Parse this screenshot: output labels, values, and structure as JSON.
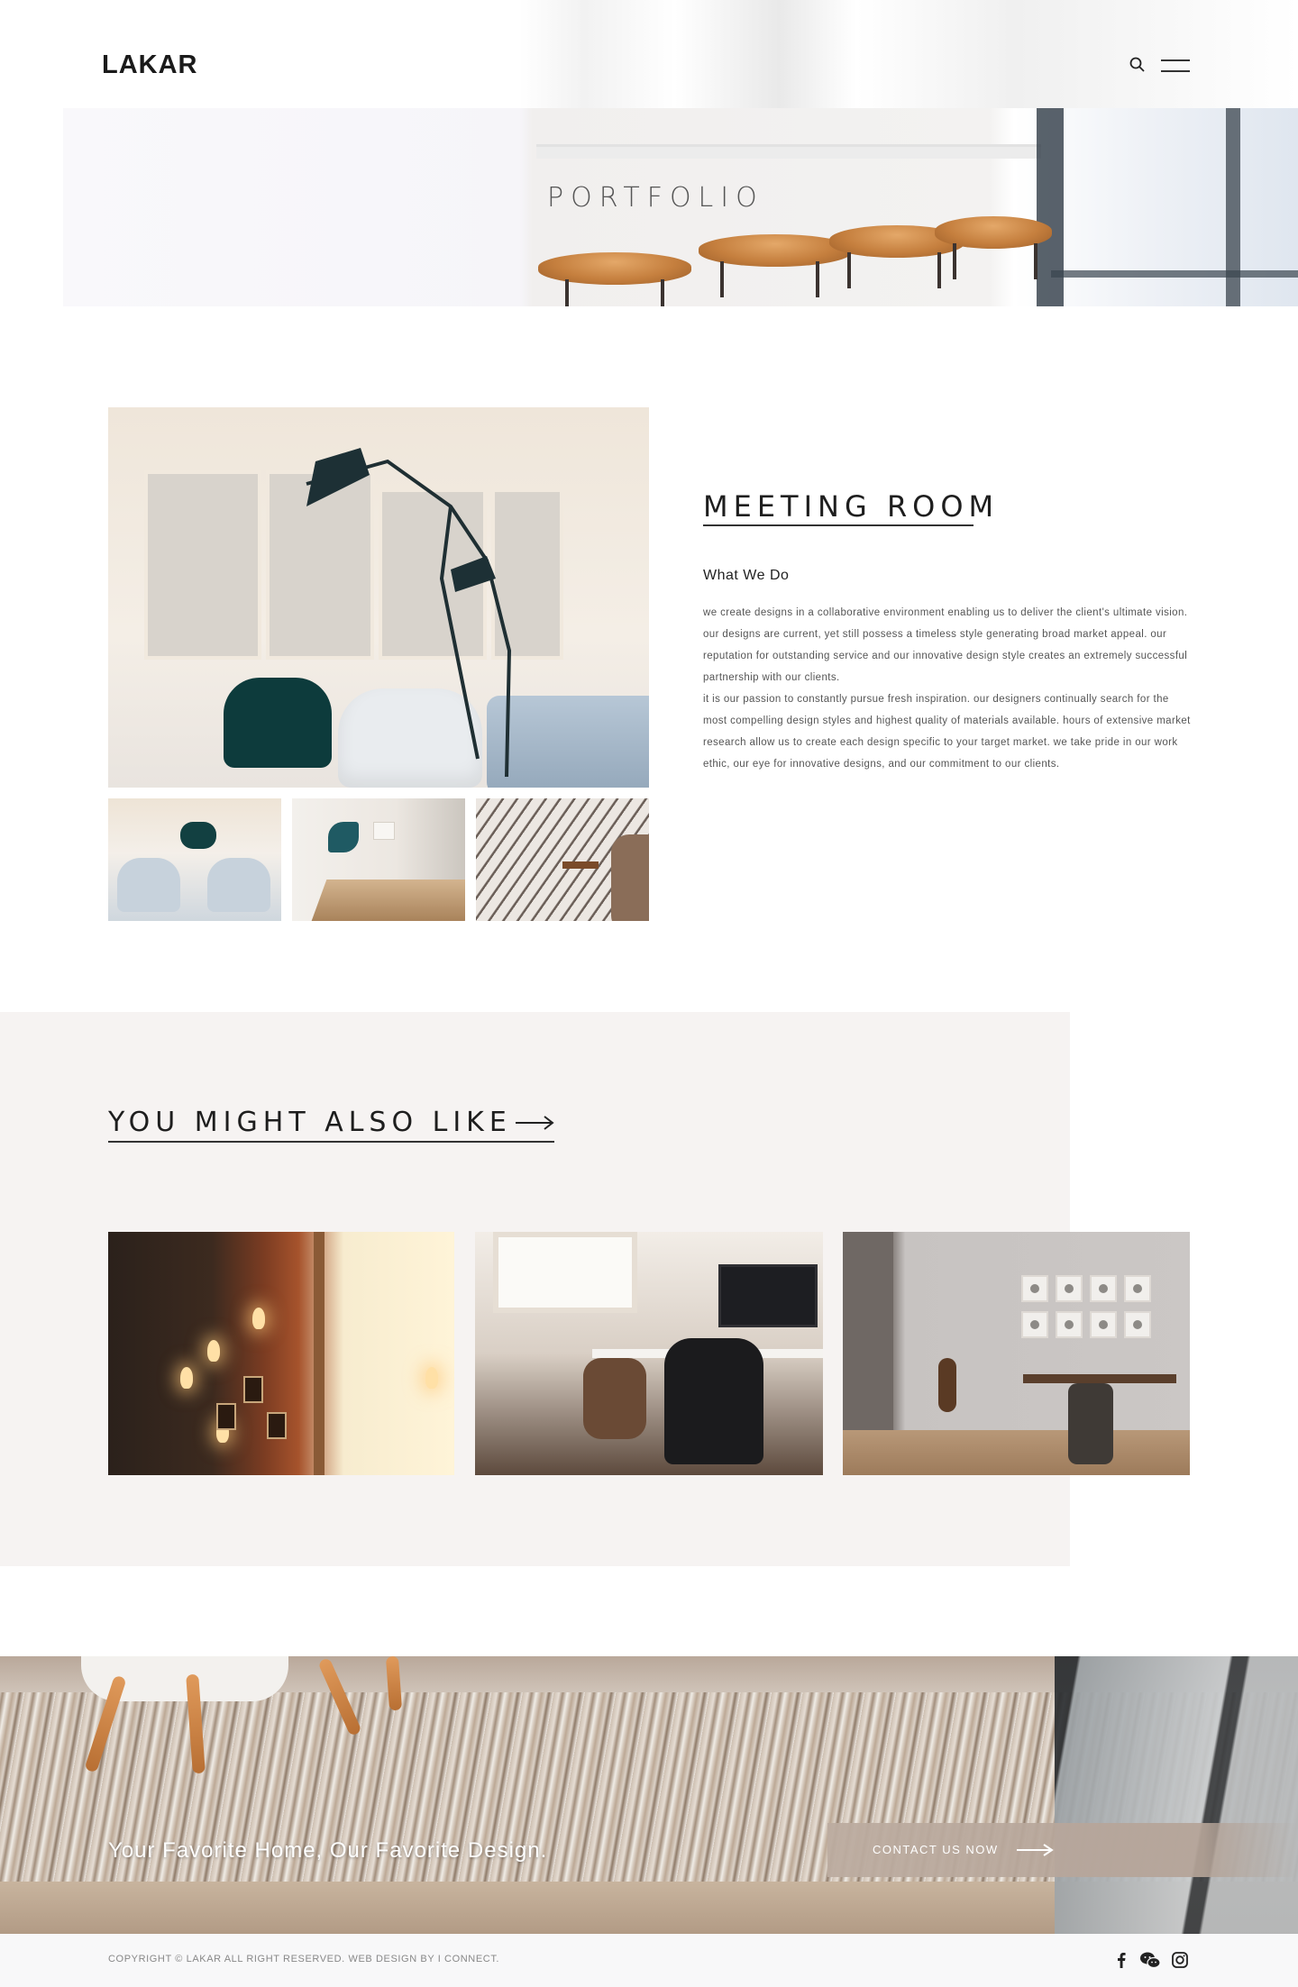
{
  "header": {
    "logo": "LAKAR",
    "icons": [
      "search-icon",
      "hamburger-menu-icon"
    ]
  },
  "hero": {
    "title": "PORTFOLIO"
  },
  "project": {
    "title": "MEETING ROOM",
    "subheading": "What We Do",
    "paragraphs": [
      "we create designs in a collaborative environment enabling us to deliver the client's ultimate vision. our designs are current, yet still possess a timeless style generating broad market appeal. our reputation for outstanding service and our innovative design style creates an extremely successful partnership with our clients.",
      "it is our passion to constantly pursue fresh inspiration. our designers continually search for the most compelling design styles and highest quality of materials available. hours of extensive market research allow us to create each design specific to your target market. we take pride in our work ethic, our eye for innovative designs, and our commitment to our clients."
    ]
  },
  "related": {
    "title": "YOU MIGHT ALSO LIKE"
  },
  "cta": {
    "tagline": "Your Favorite Home, Our Favorite Design.",
    "button_label": "CONTACT US NOW"
  },
  "footer": {
    "copyright": "COPYRIGHT © LAKAR ALL RIGHT RESERVED. WEB DESIGN BY I CONNECT.",
    "social_icons": [
      "facebook-icon",
      "wechat-icon",
      "instagram-icon"
    ]
  },
  "colors": {
    "section_bg": "#f6f3f2",
    "footer_bg": "#f8f8f9",
    "text_dark": "#1e1e1e"
  }
}
